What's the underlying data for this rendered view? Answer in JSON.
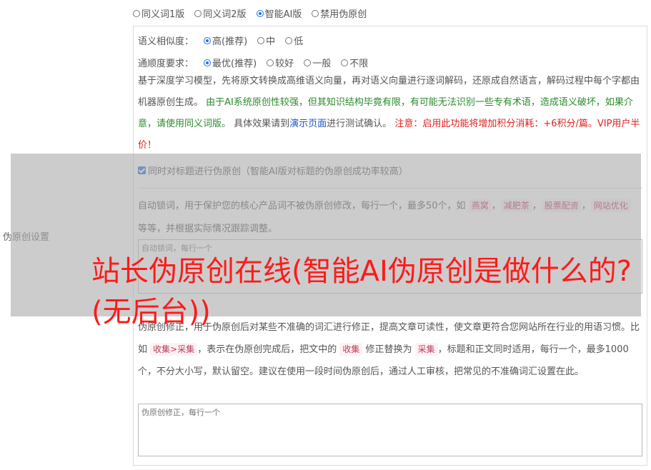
{
  "section_label": "伪原创设置",
  "modes": [
    {
      "label": "同义词1版",
      "selected": false
    },
    {
      "label": "同义词2版",
      "selected": false
    },
    {
      "label": "智能AI版",
      "selected": true
    },
    {
      "label": "禁用伪原创",
      "selected": false
    }
  ],
  "similarity": {
    "label": "语义相似度：",
    "options": [
      "高(推荐)",
      "中",
      "低"
    ],
    "selected_index": 0
  },
  "fluency": {
    "label": "通顺度要求：",
    "options": [
      "最优(推荐)",
      "较好",
      "一般",
      "不限"
    ],
    "selected_index": 0
  },
  "description": {
    "part1": "基于深度学习模型，先将原文转换成高维语义向量，再对语义向量进行逐词解码，还原成自然语言，解码过程中每个字都由机器原创生成。 ",
    "part2_green": "由于AI系统原创性较强，但其知识结构毕竟有限，有可能无法识别一些专有术语，造成语义破坏，如果介意，请使用同义词版。",
    "part3": " 具体效果请到",
    "link": "演示页面",
    "part4": "进行测试确认。 ",
    "part5_red": "注意：启用此功能将增加积分消耗：+6积分/篇。VIP用户半价！"
  },
  "title_checkbox": {
    "label": "同时对标题进行伪原创（智能AI版对标题的伪原创成功率较高）",
    "checked": true
  },
  "lock_words": {
    "desc_before": "自动锁词，用于保护您的核心产品词不被伪原创修改，每行一个，最多50个，如 ",
    "tags": [
      "燕窝",
      "减肥茶",
      "股票配资",
      "网站优化"
    ],
    "desc_after": " 等等，并根据实际情况跟踪调整。",
    "placeholder": "自动锁词，每行一个"
  },
  "correction": {
    "desc1": "伪原创修正，用于伪原创后对某些不准确的词汇进行修正，提高文章可读性，使文章更符合您网站所在行业的用语习惯。比如 ",
    "tag_example": "收集>采集",
    "desc2": "，表示在伪原创完成后，把文中的 ",
    "tag_from": "收集",
    "desc3": " 修正替换为 ",
    "tag_to": "采集",
    "desc4": "，标题和正文同时适用，每行一个，最多1000个，不分大小写，默认留空。建议在使用一段时间伪原创后，通过人工审核，把常见的不准确词汇设置在此。",
    "placeholder": "伪原创修正，每行一个"
  },
  "headline": "站长伪原创在线(智能AI伪原创是做什么的?(无后台))"
}
